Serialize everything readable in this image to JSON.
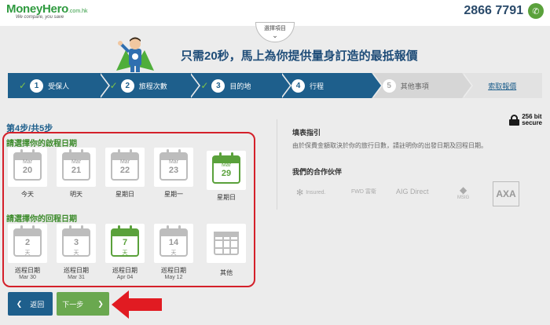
{
  "header": {
    "logo_main": "MoneyHero",
    "logo_domain": ".com.hk",
    "logo_tagline": "We compare, you save",
    "phone": "2866 7791"
  },
  "select_tab": {
    "label": "選擇項目"
  },
  "headline": "只需20秒，馬上為你提供量身訂造的最抵報價",
  "steps": [
    {
      "num": "1",
      "label": "受保人",
      "state": "done"
    },
    {
      "num": "2",
      "label": "旅程次數",
      "state": "done"
    },
    {
      "num": "3",
      "label": "目的地",
      "state": "done"
    },
    {
      "num": "4",
      "label": "行程",
      "state": "active"
    },
    {
      "num": "5",
      "label": "其他事項",
      "state": "todo"
    },
    {
      "num": "",
      "label": "索取報價",
      "state": "last"
    }
  ],
  "step_count": "第4步/共5步",
  "departure": {
    "label": "請選擇你的啟程日期",
    "dates": [
      {
        "month": "Mar",
        "day": "20",
        "caption": "今天",
        "selected": false
      },
      {
        "month": "Mar",
        "day": "21",
        "caption": "明天",
        "selected": false
      },
      {
        "month": "Mar",
        "day": "22",
        "caption": "星期日",
        "selected": false
      },
      {
        "month": "Mar",
        "day": "23",
        "caption": "星期一",
        "selected": false
      },
      {
        "month": "Mar",
        "day": "29",
        "caption": "星期日",
        "selected": true
      }
    ]
  },
  "return": {
    "label": "請選擇你的回程日期",
    "dates": [
      {
        "num": "2",
        "unit": "天",
        "caption": "巡程日期",
        "date": "Mar 30",
        "selected": false
      },
      {
        "num": "3",
        "unit": "天",
        "caption": "巡程日期",
        "date": "Mar 31",
        "selected": false
      },
      {
        "num": "7",
        "unit": "天",
        "caption": "巡程日期",
        "date": "Apr 04",
        "selected": true
      },
      {
        "num": "14",
        "unit": "天",
        "caption": "巡程日期",
        "date": "May 12",
        "selected": false
      }
    ],
    "other_label": "其他"
  },
  "buttons": {
    "back": "返回",
    "next": "下一步"
  },
  "right": {
    "secure_bits": "256 bit",
    "secure_word": "secure",
    "guide_title": "填表指引",
    "guide_text": "由於保費金額取決於你的旅行日數，請註明你的出發日期及回程日期。",
    "partners_title": "我們的合作伙伴",
    "partners": [
      "Insured.",
      "FWD 富衛",
      "AIG Direct",
      "MSIG",
      "AXA"
    ]
  },
  "colors": {
    "primary": "#1e5f8c",
    "green": "#5aa13b",
    "highlight": "#d4202a"
  }
}
